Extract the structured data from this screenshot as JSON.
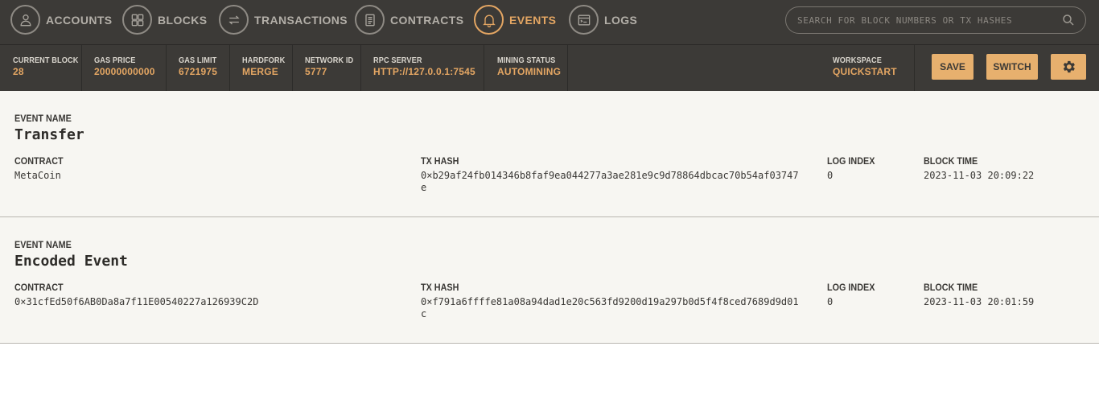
{
  "nav": {
    "items": [
      {
        "label": "ACCOUNTS",
        "icon": "account-icon"
      },
      {
        "label": "BLOCKS",
        "icon": "blocks-icon"
      },
      {
        "label": "TRANSACTIONS",
        "icon": "transactions-icon"
      },
      {
        "label": "CONTRACTS",
        "icon": "contracts-icon"
      },
      {
        "label": "EVENTS",
        "icon": "bell-icon",
        "active": true
      },
      {
        "label": "LOGS",
        "icon": "logs-icon"
      }
    ],
    "search_placeholder": "SEARCH FOR BLOCK NUMBERS OR TX HASHES"
  },
  "status": {
    "current_block": {
      "label": "CURRENT BLOCK",
      "value": "28"
    },
    "gas_price": {
      "label": "GAS PRICE",
      "value": "20000000000"
    },
    "gas_limit": {
      "label": "GAS LIMIT",
      "value": "6721975"
    },
    "hardfork": {
      "label": "HARDFORK",
      "value": "MERGE"
    },
    "network_id": {
      "label": "NETWORK ID",
      "value": "5777"
    },
    "rpc_server": {
      "label": "RPC SERVER",
      "value": "HTTP://127.0.0.1:7545"
    },
    "mining_status": {
      "label": "MINING STATUS",
      "value": "AUTOMINING"
    },
    "workspace": {
      "label": "WORKSPACE",
      "value": "QUICKSTART"
    }
  },
  "buttons": {
    "save": "SAVE",
    "switch": "SWITCH"
  },
  "labels": {
    "event_name": "EVENT NAME",
    "contract": "CONTRACT",
    "tx_hash": "TX HASH",
    "log_index": "LOG INDEX",
    "block_time": "BLOCK TIME"
  },
  "events": [
    {
      "name": "Transfer",
      "contract": "MetaCoin",
      "tx_hash": "0×b29af24fb014346b8faf9ea044277a3ae281e9c9d78864dbcac70b54af03747e",
      "log_index": "0",
      "block_time": "2023-11-03 20:09:22"
    },
    {
      "name": "Encoded Event",
      "contract": "0×31cfEd50f6AB0Da8a7f11E00540227a126939C2D",
      "tx_hash": "0×f791a6ffffe81a08a94dad1e20c563fd9200d19a297b0d5f4f8ced7689d9d01c",
      "log_index": "0",
      "block_time": "2023-11-03 20:01:59"
    }
  ],
  "colors": {
    "header_bg": "#3c3a37",
    "accent": "#e4a663",
    "row_bg": "#f7f6f2"
  }
}
